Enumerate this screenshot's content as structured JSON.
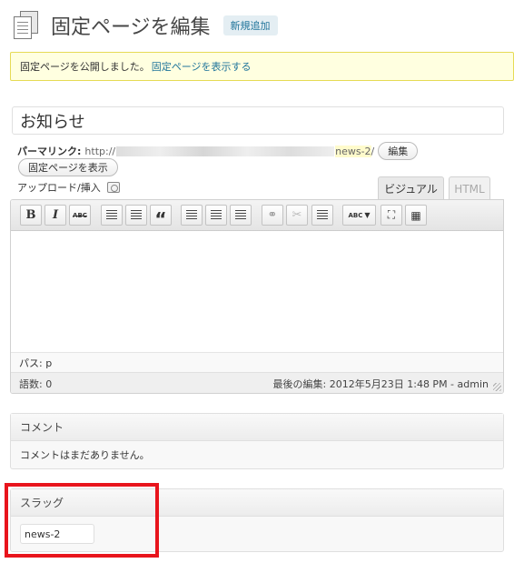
{
  "header": {
    "title": "固定ページを編集",
    "add_new_label": "新規追加"
  },
  "notice": {
    "message": "固定ページを公開しました。",
    "link": "固定ページを表示する"
  },
  "post": {
    "title": "お知らせ"
  },
  "permalink": {
    "label": "パーマリンク:",
    "prefix": "http://",
    "slug": "news-2",
    "trailing": "/",
    "edit_label": "編集",
    "view_label": "固定ページを表示"
  },
  "editor": {
    "upload_label": "アップロード/挿入",
    "tabs": [
      "ビジュアル",
      "HTML"
    ],
    "toolbar": {
      "bold": "B",
      "italic": "I",
      "strike": "ABC",
      "quote": "“",
      "spell": "ABC"
    },
    "path_label": "パス: p",
    "word_count": "語数: 0",
    "last_edited": "最後の編集: 2012年5月23日 1:48 PM - admin"
  },
  "comments": {
    "heading": "コメント",
    "empty_message": "コメントはまだありません。"
  },
  "slug_box": {
    "heading": "スラッグ",
    "value": "news-2"
  },
  "colors": {
    "highlight_frame": "#e8141c",
    "link": "#21759b",
    "notice_bg": "#ffffe0"
  }
}
